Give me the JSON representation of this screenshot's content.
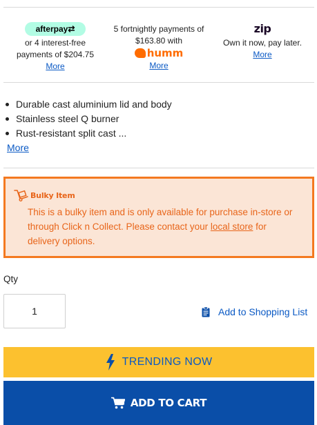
{
  "payments": {
    "afterpay": {
      "logo_text": "afterpay",
      "line1": "or 4 interest-free",
      "line2": "payments of $204.75",
      "more": "More"
    },
    "humm": {
      "line1": "5 fortnightly payments of",
      "line2": "$163.80 with",
      "logo_text": "humm",
      "more": "More"
    },
    "zip": {
      "logo_text": "zip",
      "line1": "Own it now, pay later.",
      "more": "More"
    }
  },
  "features": {
    "items": [
      "Durable cast aluminium lid and body",
      "Stainless steel Q burner",
      "Rust-resistant split cast ..."
    ],
    "more": "More"
  },
  "bulky": {
    "title": "Bulky Item",
    "text_before": "This is a bulky item and is only available for purchase in-store or through Click n Collect. Please contact your ",
    "link": "local store",
    "text_after": " for delivery options.",
    "accent_color": "#f47920"
  },
  "qty": {
    "label": "Qty",
    "value": "1"
  },
  "shopping_list": {
    "label": "Add to Shopping List",
    "icon": "clipboard-icon"
  },
  "buttons": {
    "trending": "TRENDING NOW",
    "add_to_cart": "ADD TO CART",
    "trending_color": "#fcc12f",
    "cart_color": "#0a4ea8"
  }
}
